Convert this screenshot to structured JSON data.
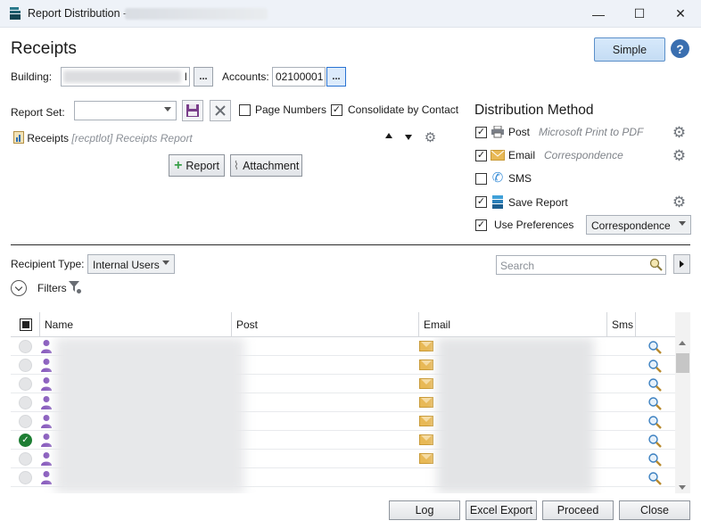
{
  "window": {
    "title": "Report Distribution -",
    "minimize_glyph": "—",
    "maximize_glyph": "☐",
    "close_glyph": "✕"
  },
  "header": {
    "title": "Receipts",
    "simple_button": "Simple",
    "help_button": "?"
  },
  "filters_top": {
    "building_label": "Building:",
    "building_value": "l",
    "building_browse": "...",
    "accounts_label": "Accounts:",
    "accounts_value": "02100001",
    "accounts_browse": "..."
  },
  "report_set": {
    "label": "Report Set:",
    "value": "",
    "page_numbers_label": "Page Numbers",
    "page_numbers_checked": false,
    "consolidate_label": "Consolidate by Contact",
    "consolidate_checked": true,
    "report_name": "Receipts",
    "report_sub": "[recptlot] Receipts Report",
    "add_report_button": "Report",
    "add_attachment_button": "Attachment"
  },
  "distribution": {
    "title": "Distribution Method",
    "methods": [
      {
        "label": "Post",
        "sub": "Microsoft Print to PDF",
        "checked": true,
        "icon": "printer-icon"
      },
      {
        "label": "Email",
        "sub": "Correspondence",
        "checked": true,
        "icon": "envelope-icon"
      },
      {
        "label": "SMS",
        "sub": "",
        "checked": false,
        "icon": "phone-icon"
      },
      {
        "label": "Save Report",
        "sub": "",
        "checked": true,
        "icon": "save-report-icon"
      }
    ],
    "use_preferences_label": "Use Preferences",
    "use_preferences_checked": true,
    "preferences_value": "Correspondence"
  },
  "recipients": {
    "type_label": "Recipient Type:",
    "type_value": "Internal Users",
    "search_placeholder": "Search",
    "filters_label": "Filters",
    "columns": [
      "Name",
      "Post",
      "Email",
      "Sms"
    ],
    "rows": [
      {
        "selected": false,
        "has_email": true
      },
      {
        "selected": false,
        "has_email": true
      },
      {
        "selected": false,
        "has_email": true
      },
      {
        "selected": false,
        "has_email": true
      },
      {
        "selected": false,
        "has_email": true
      },
      {
        "selected": true,
        "has_email": true
      },
      {
        "selected": false,
        "has_email": true
      },
      {
        "selected": false,
        "has_email": false
      }
    ]
  },
  "footer": {
    "log_button": "Log",
    "excel_button": "Excel Export",
    "proceed_button": "Proceed",
    "close_button": "Close"
  },
  "colors": {
    "accent": "#3a6fb0",
    "checkmark_green": "#1e7e34",
    "envelope": "#e8b956",
    "person": "#8b5fbf"
  }
}
